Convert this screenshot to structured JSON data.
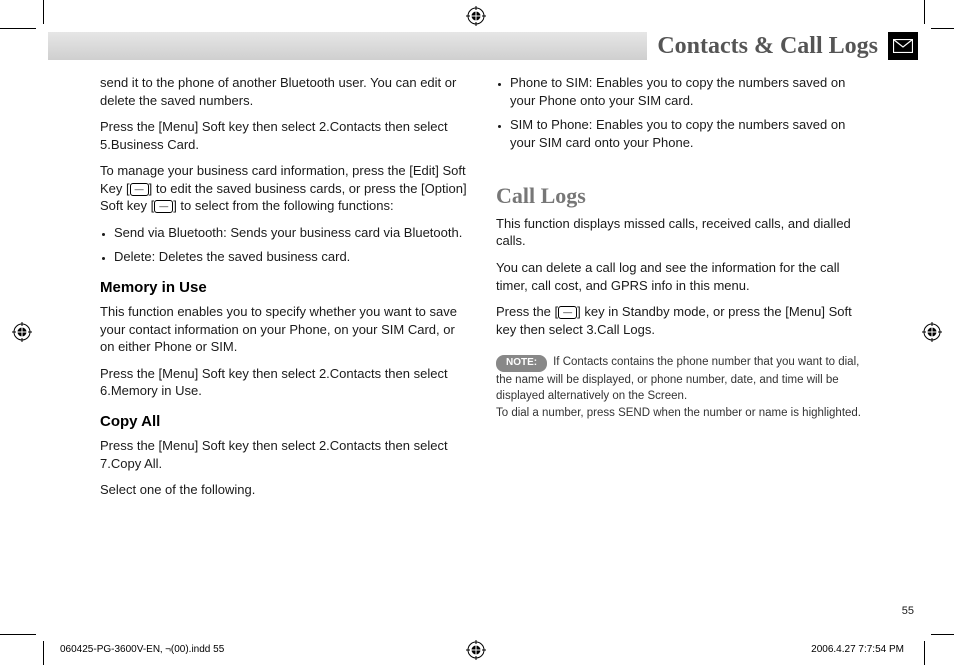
{
  "chapter": {
    "title": "Contacts & Call Logs"
  },
  "left": {
    "p1": "send it to the phone of another Bluetooth user. You can edit or delete the saved numbers.",
    "p2": "Press the [Menu] Soft key then select 2.Contacts then select 5.Business Card.",
    "p3_a": "To manage your business card information, press the [Edit] Soft Key [",
    "p3_b": "] to edit the saved business cards, or press the [Option] Soft key [",
    "p3_c": "] to select from the following functions:",
    "bul1": "Send via Bluetooth: Sends your business card via Bluetooth.",
    "bul2": "Delete: Deletes the saved business card.",
    "h_mem": "Memory in Use",
    "mem_p1": "This function enables you to specify whether you want to save your contact information on your Phone, on your SIM Card, or on either Phone or SIM.",
    "mem_p2": "Press the [Menu] Soft key then select 2.Contacts then select 6.Memory in Use.",
    "h_copy": "Copy All",
    "copy_p1": "Press the [Menu] Soft key then select 2.Contacts then select 7.Copy All.",
    "copy_p2": "Select one of the following."
  },
  "right": {
    "bul1": "Phone to SIM: Enables you to copy the numbers saved on your Phone onto your SIM card.",
    "bul2": "SIM to Phone: Enables you to copy the numbers saved on your SIM card onto your Phone.",
    "h_call": "Call Logs",
    "call_p1": "This function displays missed calls, received calls, and dialled calls.",
    "call_p2": "You can delete a call log and see the information for the call timer, call cost, and GPRS info in this menu.",
    "call_p3_a": "Press the [",
    "call_p3_b": "] key in Standby mode, or press the [Menu] Soft key then select 3.Call Logs.",
    "note_label": "NOTE:",
    "note_body": "If Contacts contains the phone number that you want to dial, the name will be displayed, or phone number, date, and time will be displayed alternatively on the Screen.\nTo dial a number, press SEND when the number or name is highlighted."
  },
  "keys": {
    "left_soft": "—",
    "right_soft": "—",
    "send": "—"
  },
  "page_number": "55",
  "footer": {
    "left": "060425-PG-3600V-EN‚ ¬(00).indd   55",
    "right": "2006.4.27   7:7:54 PM"
  }
}
